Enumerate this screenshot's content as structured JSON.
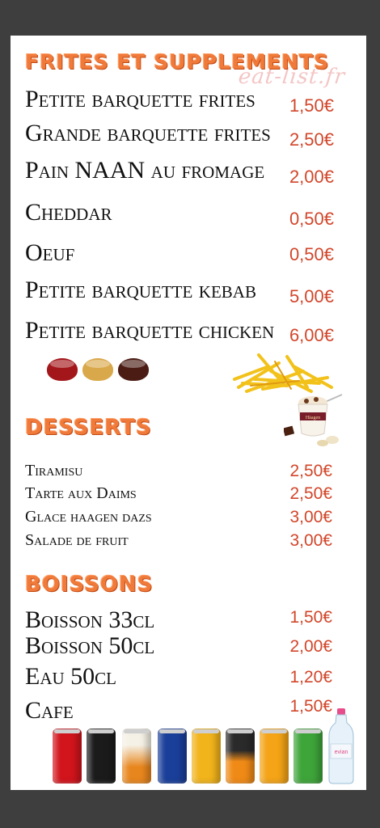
{
  "watermark": "eat-list.fr",
  "sections": {
    "frites": {
      "title": "FRITES ET SUPPLEMENTS",
      "items": [
        {
          "name": "Petite barquette frites",
          "price": "1,50€"
        },
        {
          "name": "Grande barquette frites",
          "price": "2,50€"
        },
        {
          "name": "Pain NAAN au fromage",
          "price": "2,00€"
        },
        {
          "name": "Cheddar",
          "price": "0,50€"
        },
        {
          "name": "Oeuf",
          "price": "0,50€"
        },
        {
          "name": "Petite barquette kebab",
          "price": "5,00€"
        },
        {
          "name": "Petite barquette chicken",
          "price": "6,00€"
        }
      ]
    },
    "desserts": {
      "title": "DESSERTS",
      "items": [
        {
          "name": "Tiramisu",
          "price": "2,50€"
        },
        {
          "name": "Tarte aux Daims",
          "price": "2,50€"
        },
        {
          "name": "Glace haagen dazs",
          "price": "3,00€"
        },
        {
          "name": "Salade de fruit",
          "price": "3,00€"
        }
      ]
    },
    "boissons": {
      "title": "BOISSONS",
      "items": [
        {
          "name": "Boisson 33cl",
          "price": "1,50€"
        },
        {
          "name": "Boisson 50cl",
          "price": "2,00€"
        },
        {
          "name": "Eau 50cl",
          "price": "1,20€"
        },
        {
          "name": "Cafe",
          "price": "1,50€"
        }
      ]
    }
  },
  "images": {
    "sauces": "sauce-cups-image",
    "fries": "fries-image",
    "icecream": "haagen-dazs-icecream-image",
    "cans": "soda-cans-image",
    "bottle": "evian-bottle-image"
  },
  "colors": {
    "background": "#3e3e3e",
    "panel": "#ffffff",
    "heading": "#f07a3a",
    "price": "#d2462a",
    "text": "#111111"
  }
}
